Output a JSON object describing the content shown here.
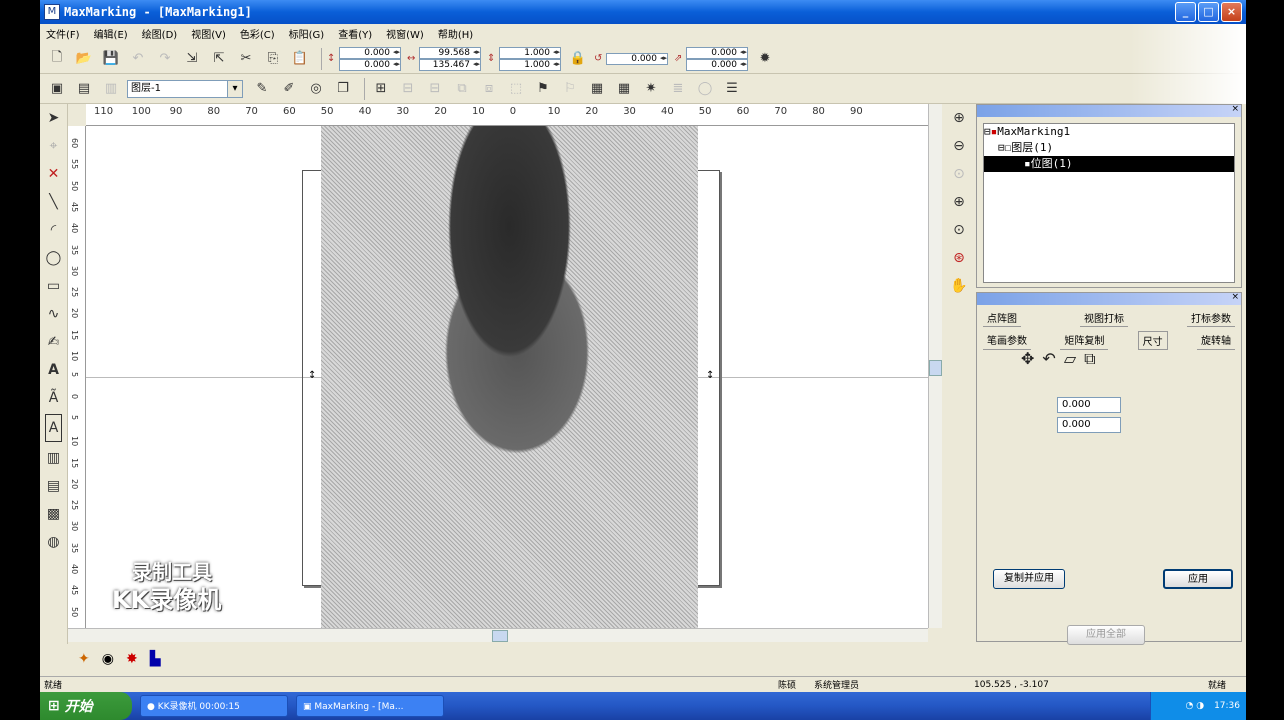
{
  "window": {
    "title": "MaxMarking - [MaxMarking1]",
    "icon": "app-icon"
  },
  "window_buttons": {
    "minimize": "_",
    "maximize": "□",
    "close": "×"
  },
  "menu": [
    "文件(F)",
    "编辑(E)",
    "绘图(D)",
    "视图(V)",
    "色彩(C)",
    "标阳(G)",
    "查看(Y)",
    "视窗(W)",
    "帮助(H)"
  ],
  "toolbar1": {
    "pos_x": "0.000",
    "pos_y": "0.000",
    "size_w": "99.568",
    "size_h": "135.467",
    "scale_x": "1.000",
    "scale_y": "1.000",
    "rotate": "0.000",
    "skew_x": "0.000",
    "skew_y": "0.000"
  },
  "toolbar2": {
    "layer": "图层-1"
  },
  "ruler_h": [
    "110",
    "100",
    "90",
    "80",
    "70",
    "60",
    "50",
    "40",
    "30",
    "20",
    "10",
    "0",
    "10",
    "20",
    "30",
    "40",
    "50",
    "60",
    "70",
    "80",
    "90"
  ],
  "ruler_v": [
    "60",
    "55",
    "50",
    "45",
    "40",
    "35",
    "30",
    "25",
    "20",
    "15",
    "10",
    "5",
    "0",
    "5",
    "10",
    "15",
    "20",
    "25",
    "30",
    "35",
    "40",
    "45",
    "50"
  ],
  "object_panel": {
    "tree": [
      "MaxMarking1",
      "图层(1)",
      "位图(1)"
    ]
  },
  "prop_panel": {
    "tabs_row1": [
      "点阵图",
      "视图打标",
      "打标参数"
    ],
    "tabs_row2": [
      "笔画参数",
      "矩阵复制",
      "尺寸",
      "旋转轴"
    ],
    "field1": "0.000",
    "field2": "0.000",
    "copy_apply": "复制并应用",
    "apply": "应用",
    "apply_all": "应用全部"
  },
  "status": {
    "left": "就绪",
    "user_label": "陈硕",
    "user": "系统管理员",
    "coords": "105.525 , -3.107",
    "right": "就绪"
  },
  "taskbar": {
    "start": "开始",
    "task1": "KK录像机 00:00:15",
    "task2": "MaxMarking - [Ma...",
    "clock": "17:36"
  },
  "watermark": {
    "line1": "录制工具",
    "line2": "KK录像机"
  }
}
